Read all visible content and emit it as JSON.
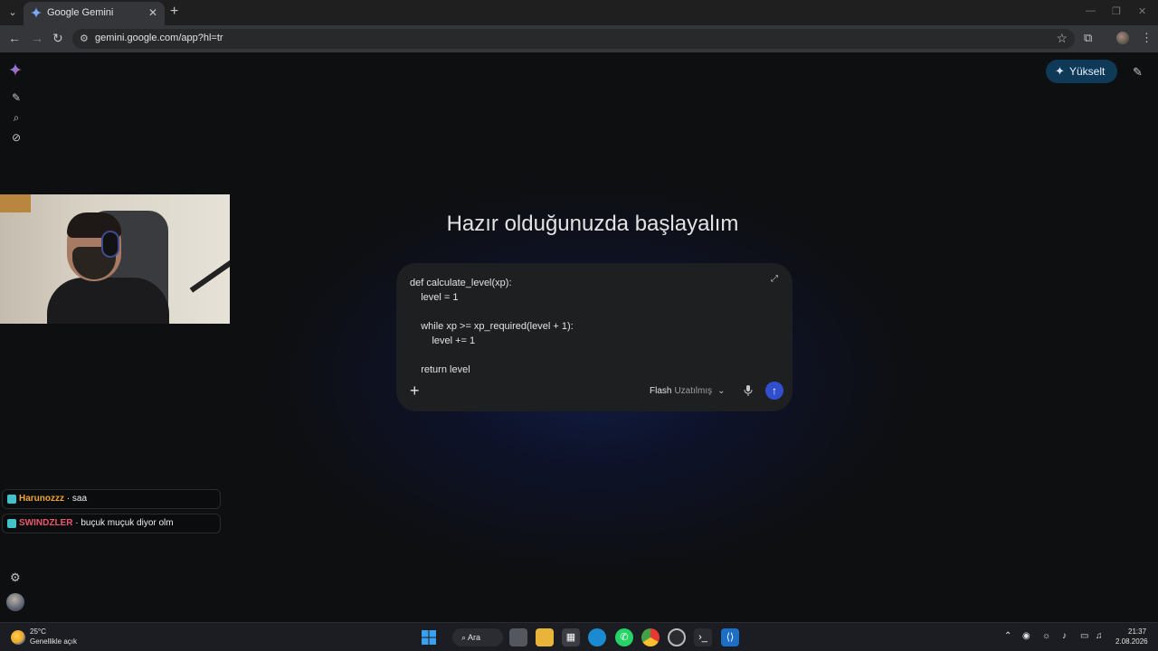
{
  "browser": {
    "tab_title": "Google Gemini",
    "url": "gemini.google.com/app?hl=tr"
  },
  "header": {
    "upgrade_label": "Yükselt"
  },
  "main": {
    "greeting": "Hazır olduğunuzda başlayalım",
    "prompt_text": "def calculate_level(xp):\n    level = 1\n\n    while xp >= xp_required(level + 1):\n        level += 1\n\n    return level",
    "model": "Flash",
    "model_variant": "Uzatılmış"
  },
  "chat": [
    {
      "user": "Harunozzz",
      "message": "saa",
      "color": "#f0a33a"
    },
    {
      "user": "SWINDZLER",
      "message": "buçuk muçuk diyor olm",
      "color": "#e85a6f"
    }
  ],
  "taskbar": {
    "weather_temp": "25°C",
    "weather_desc": "Genellikle açık",
    "search_label": "Ara",
    "time": "21:37",
    "date": "2.08.2026"
  },
  "colors": {
    "accent": "#2f4fcf",
    "upgrade_bg": "#0f3a57"
  }
}
